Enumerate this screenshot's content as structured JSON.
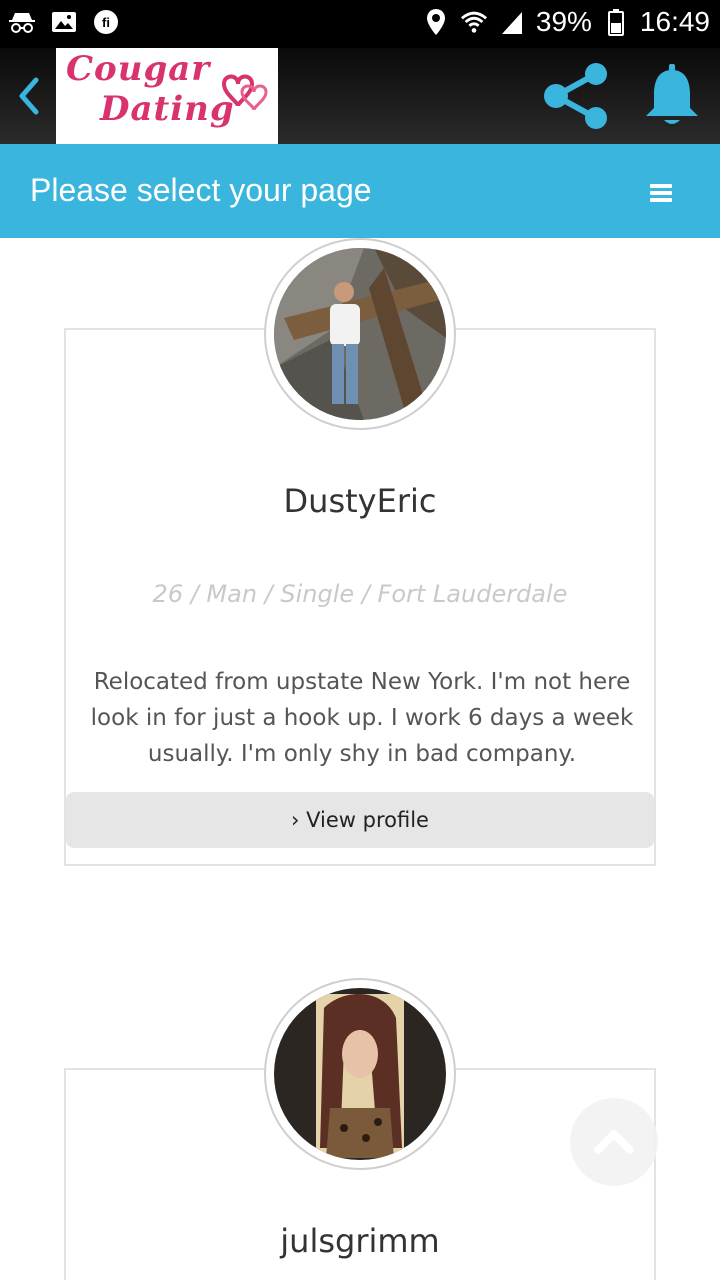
{
  "status_bar": {
    "battery_percent": "39%",
    "time": "16:49",
    "icons": [
      "incognito-icon",
      "image-icon",
      "fi-icon",
      "location-icon",
      "wifi-icon",
      "signal-icon",
      "battery-icon"
    ]
  },
  "header": {
    "logo_line1": "Cougar",
    "logo_line2": "Dating"
  },
  "selector": {
    "title": "Please select your page"
  },
  "profiles": [
    {
      "name": "DustyEric",
      "meta": "26 / Man / Single / Fort Lauderdale",
      "bio": "Relocated from upstate New York. I'm not here look in for just a hook up. I work 6 days a week usually. I'm only shy in bad company.",
      "button": "› View profile"
    },
    {
      "name": "julsgrimm"
    }
  ],
  "colors": {
    "accent": "#3ab5dd",
    "logo_pink": "#d8336e"
  }
}
